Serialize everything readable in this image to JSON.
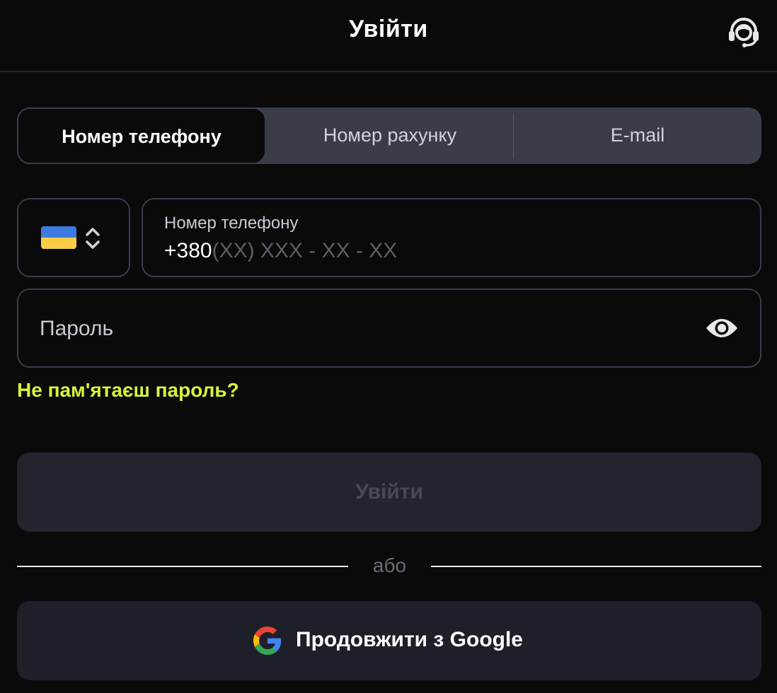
{
  "header": {
    "title": "Увійти",
    "support_icon": "headset-icon"
  },
  "tabs": [
    {
      "label": "Номер телефону",
      "active": true
    },
    {
      "label": "Номер рахунку",
      "active": false
    },
    {
      "label": "E-mail",
      "active": false
    }
  ],
  "country": {
    "flag": "ukraine-flag-icon",
    "selector_icon": "chevron-up-down-icon"
  },
  "phone": {
    "label": "Номер телефону",
    "prefix": "+380",
    "mask": "(XX) XXX - XX - XX"
  },
  "password": {
    "placeholder": "Пароль",
    "toggle_icon": "eye-icon"
  },
  "forgot_link": "Не пам'ятаєш пароль?",
  "login_button": "Увійти",
  "separator": "або",
  "google_button": {
    "label": "Продовжити з Google",
    "icon": "google-icon"
  },
  "colors": {
    "background": "#0a0a0b",
    "accent": "#d4f53c",
    "tab_bar": "#3a3c4a",
    "disabled_button": "#24242f"
  }
}
